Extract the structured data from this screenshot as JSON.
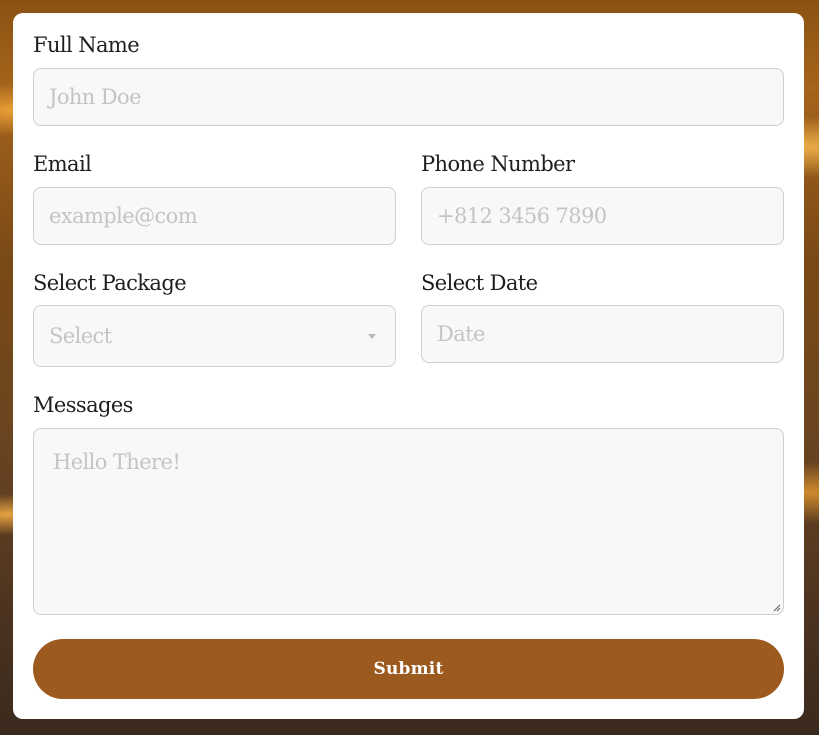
{
  "form": {
    "full_name": {
      "label": "Full Name",
      "placeholder": "John Doe",
      "value": ""
    },
    "email": {
      "label": "Email",
      "placeholder": "example@com",
      "value": ""
    },
    "phone": {
      "label": "Phone Number",
      "placeholder": "+812 3456 7890",
      "value": ""
    },
    "package": {
      "label": "Select Package",
      "selected": "Select"
    },
    "date": {
      "label": "Select Date",
      "placeholder": "Date",
      "value": ""
    },
    "messages": {
      "label": "Messages",
      "placeholder": "Hello There!",
      "value": ""
    },
    "submit_label": "Submit"
  },
  "colors": {
    "accent": "#9c5a1e",
    "field_background": "#f8f8f8",
    "field_border": "#cfcfcf",
    "placeholder": "#c4c4c4",
    "label": "#1e1e1e"
  },
  "icons": {
    "select_caret": "chevron-down-icon",
    "resize_grip": "resize-handle-icon"
  }
}
